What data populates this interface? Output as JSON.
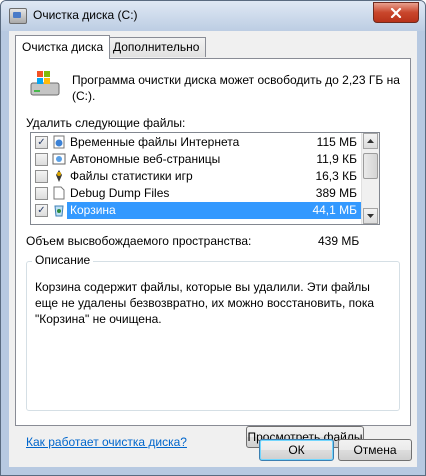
{
  "window": {
    "title": "Очистка диска  (C:)"
  },
  "tabs": [
    {
      "label": "Очистка диска",
      "active": true
    },
    {
      "label": "Дополнительно",
      "active": false
    }
  ],
  "intro_text": "Программа очистки диска может освободить до 2,23 ГБ на  (C:).",
  "files_label": "Удалить следующие файлы:",
  "files": [
    {
      "name": "Временные файлы Интернета",
      "size": "115 МБ",
      "checked": true,
      "selected": false,
      "icon": "internet-files-icon"
    },
    {
      "name": "Автономные веб-страницы",
      "size": "11,9 КБ",
      "checked": false,
      "selected": false,
      "icon": "offline-pages-icon"
    },
    {
      "name": "Файлы статистики игр",
      "size": "16,3 КБ",
      "checked": false,
      "selected": false,
      "icon": "game-stats-icon"
    },
    {
      "name": "Debug Dump Files",
      "size": "389 МБ",
      "checked": false,
      "selected": false,
      "icon": "file-icon"
    },
    {
      "name": "Корзина",
      "size": "44,1 МБ",
      "checked": true,
      "selected": true,
      "icon": "recycle-bin-icon"
    }
  ],
  "space_label": "Объем высвобождаемого пространства:",
  "space_value": "439 МБ",
  "description": {
    "title": "Описание",
    "text": "Корзина содержит файлы, которые вы удалили. Эти файлы еще не удалены безвозвратно, их можно восстановить, пока \"Корзина\" не очищена."
  },
  "view_files_button": "Просмотреть файлы",
  "help_link": "Как работает очистка диска?",
  "ok_button": "ОК",
  "cancel_button": "Отмена",
  "colors": {
    "selection": "#3399ff",
    "link": "#0066cc",
    "close": "#c9462c"
  }
}
